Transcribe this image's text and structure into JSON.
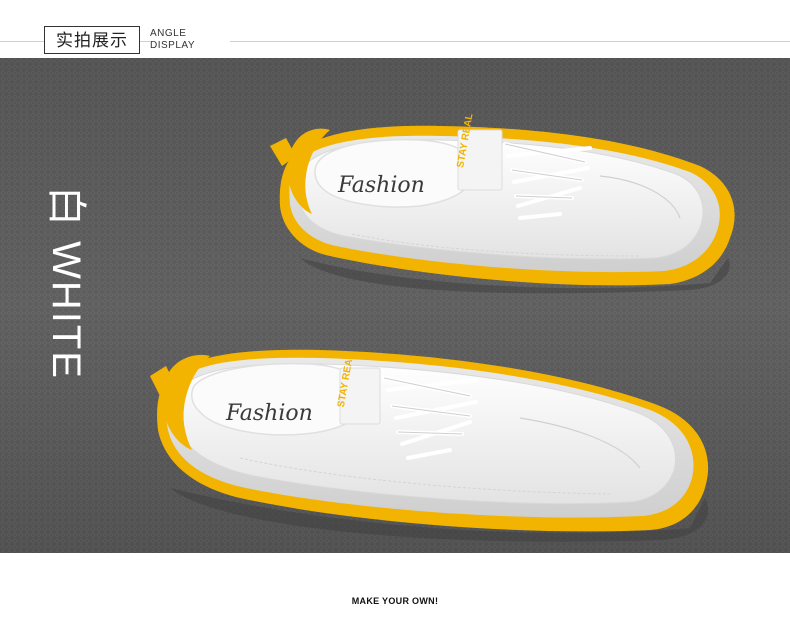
{
  "header": {
    "title_cn": "实拍展示",
    "subtitle_line1": "ANGLE",
    "subtitle_line2": "DISPLAY"
  },
  "photo": {
    "color_label": "白 WHITE",
    "shoe_top_insole_text": "Fashion",
    "shoe_bottom_insole_text": "Fashion",
    "tongue_label_text": "STAY REAL",
    "colors": {
      "carpet": "#5d5d5d",
      "shoe_upper": "#f4f4f4",
      "sole_accent": "#f2b400"
    }
  },
  "footer": {
    "tagline": "MAKE YOUR OWN!"
  }
}
